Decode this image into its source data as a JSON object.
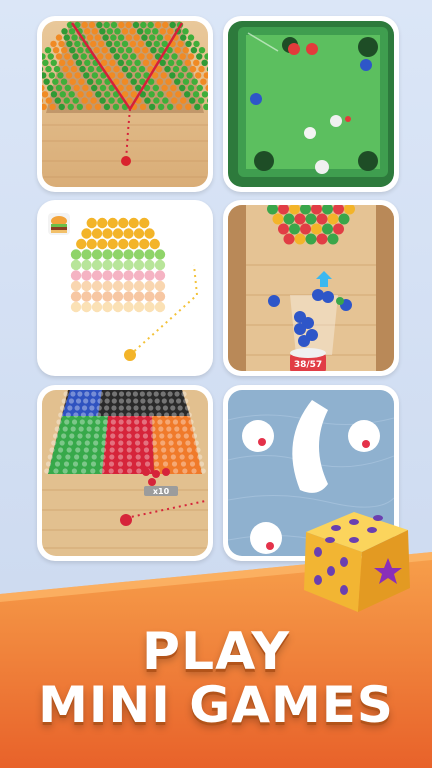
{
  "headline": {
    "line1": "PLAY",
    "line2": "MINI GAMES"
  },
  "tiles": [
    {
      "name": "ball-rain-wood-lane"
    },
    {
      "name": "pool-table-holes"
    },
    {
      "name": "burger-bubble-shooter"
    },
    {
      "name": "ball-launcher-counter",
      "counter": "38/57"
    },
    {
      "name": "color-block-lane",
      "multiplier": "x10"
    },
    {
      "name": "hole-ball-drop"
    }
  ],
  "colors": {
    "background": "#d6e3f5",
    "banner_top": "#f7a04b",
    "banner_bottom": "#e8622a",
    "title_text": "#ffffff",
    "dice": "#f6c03f",
    "dice_pips": "#6a3fb0"
  },
  "icons": [
    "dice-icon",
    "burger-icon",
    "star-icon",
    "arrow-up-icon"
  ]
}
